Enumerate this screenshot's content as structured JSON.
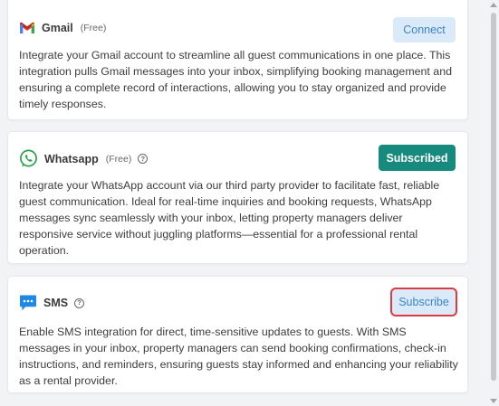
{
  "integrations": {
    "gmail": {
      "title": "Gmail",
      "tag": "(Free)",
      "description": "Integrate your Gmail account to streamline all guest communications in one place. This integration pulls Gmail messages into your inbox, simplifying booking management and ensuring a complete record of interactions, allowing you to stay organized and provide timely responses.",
      "button_label": "Connect",
      "icon": "gmail-logo-icon"
    },
    "whatsapp": {
      "title": "Whatsapp",
      "tag": "(Free)",
      "help_glyph": "?",
      "description": "Integrate your WhatsApp account via our third party provider to facilitate fast, reliable guest communication. Ideal for real-time inquiries and booking requests, WhatsApp messages sync seamlessly with your inbox, letting property managers deliver responsive service without juggling platforms—essential for a professional rental operation.",
      "button_label": "Subscribed",
      "icon": "whatsapp-logo-icon"
    },
    "sms": {
      "title": "SMS",
      "help_glyph": "?",
      "description": "Enable SMS integration for direct, time-sensitive updates to guests. With SMS messages in your inbox, property managers can send booking confirmations, check-in instructions, and reminders, ensuring guests stay informed and enhancing your reliability as a rental provider.",
      "button_label": "Subscribe",
      "icon": "sms-chat-icon"
    }
  },
  "colors": {
    "accent_green": "#168a7c",
    "light_blue_button": "#dbeaf8",
    "highlight_red": "#e0393e",
    "sms_icon_blue": "#1e88e5",
    "whatsapp_green": "#25a244"
  }
}
